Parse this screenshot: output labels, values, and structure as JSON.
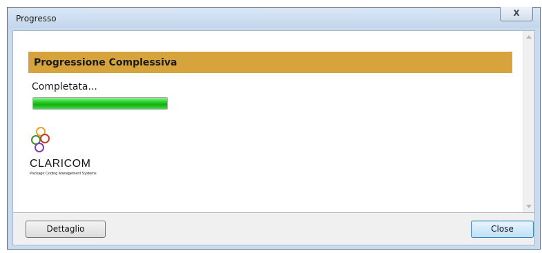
{
  "window": {
    "title": "Progresso",
    "close_glyph": "X",
    "close_icon": "close-icon"
  },
  "section": {
    "header": "Progressione Complessiva",
    "status": "Completata..."
  },
  "progress": {
    "value_percent": 100,
    "color": "#1ec01e"
  },
  "logo": {
    "name": "CLARICOM",
    "tagline": "Package Coding Management Systems"
  },
  "footer": {
    "dettaglio_label": "Dettaglio",
    "close_label": "Close"
  },
  "colors": {
    "header_bar": "#d6a33c",
    "titlebar": "#c9dbee"
  }
}
